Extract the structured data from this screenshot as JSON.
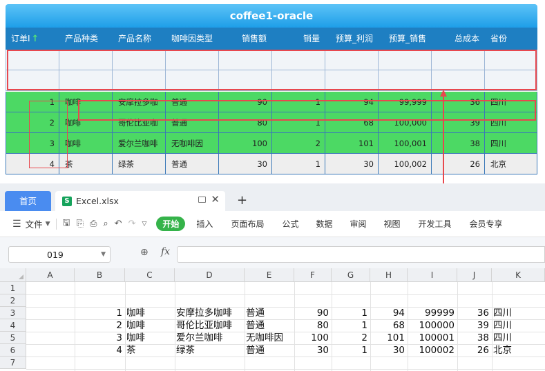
{
  "report": {
    "title": "coffee1-oracle",
    "columns": [
      "订单I",
      "产品种类",
      "产品名称",
      "咖啡因类型",
      "销售额",
      "销量",
      "预算_利润",
      "预算_销售",
      "总成本",
      "省份"
    ],
    "sort_icon": "sort-ascending-arrow-icon",
    "rows": [
      [
        "1",
        "咖啡",
        "安摩拉多咖",
        "普通",
        "90",
        "1",
        "94",
        "99,999",
        "36",
        "四川"
      ],
      [
        "2",
        "咖啡",
        "哥伦比亚咖",
        "普通",
        "80",
        "1",
        "68",
        "100,000",
        "39",
        "四川"
      ],
      [
        "3",
        "咖啡",
        "爱尔兰咖啡",
        "无咖啡因",
        "100",
        "2",
        "101",
        "100,001",
        "38",
        "四川"
      ],
      [
        "4",
        "茶",
        "绿茶",
        "普通",
        "30",
        "1",
        "30",
        "100,002",
        "26",
        "北京"
      ]
    ],
    "row_colors": [
      "#4cd964",
      "#4cd964",
      "#4cd964",
      "#eeeeee"
    ]
  },
  "spreadsheet": {
    "tabs": {
      "home": "首页",
      "file": "Excel.xlsx"
    },
    "ribbon": {
      "file_menu": "文件",
      "tabs": [
        "开始",
        "插入",
        "页面布局",
        "公式",
        "数据",
        "审阅",
        "视图",
        "开发工具",
        "会员专享"
      ]
    },
    "name_box": "019",
    "fx_label": "fx",
    "column_headers": [
      "A",
      "B",
      "C",
      "D",
      "E",
      "F",
      "G",
      "H",
      "I",
      "J",
      "K"
    ],
    "row_headers": [
      "1",
      "2",
      "3",
      "4",
      "5",
      "6",
      "7"
    ],
    "rows": [
      [
        "1",
        "咖啡",
        "安摩拉多咖啡",
        "普通",
        "90",
        "1",
        "94",
        "99999",
        "36",
        "四川"
      ],
      [
        "2",
        "咖啡",
        "哥伦比亚咖啡",
        "普通",
        "80",
        "1",
        "68",
        "100000",
        "39",
        "四川"
      ],
      [
        "3",
        "咖啡",
        "爱尔兰咖啡",
        "无咖啡因",
        "100",
        "2",
        "101",
        "100001",
        "38",
        "四川"
      ],
      [
        "4",
        "茶",
        "绿茶",
        "普通",
        "30",
        "1",
        "30",
        "100002",
        "26",
        "北京"
      ]
    ]
  },
  "colors": {
    "accent": "#1e7fc2",
    "highlight": "#e8474e",
    "green_row": "#4cd964",
    "start_pill": "#35b34a"
  }
}
